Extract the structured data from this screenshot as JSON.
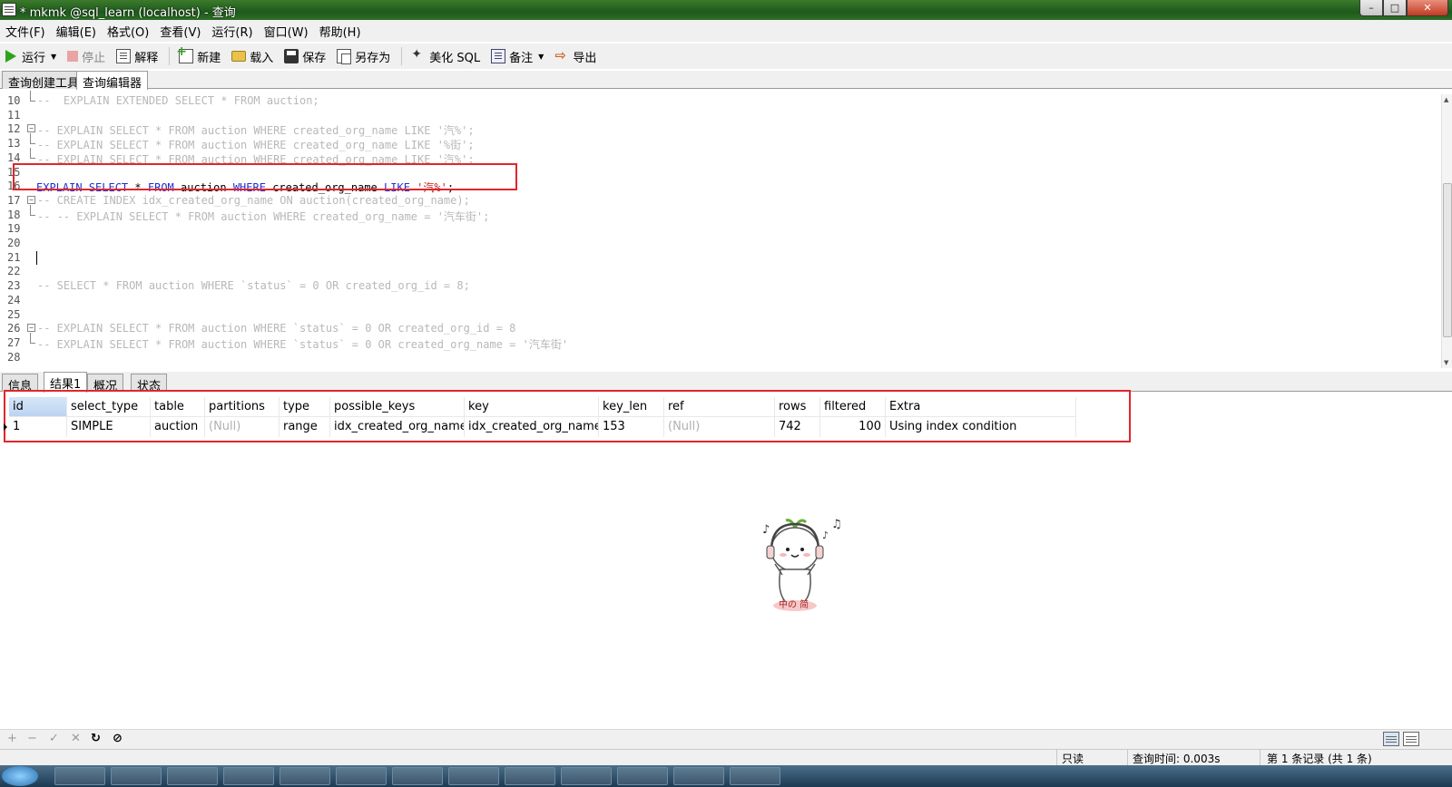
{
  "window": {
    "title": "* mkmk @sql_learn (localhost) - 查询",
    "controls": {
      "minimize": "–",
      "maximize": "□",
      "close": "✕"
    }
  },
  "menu": [
    "文件(F)",
    "编辑(E)",
    "格式(O)",
    "查看(V)",
    "运行(R)",
    "窗口(W)",
    "帮助(H)"
  ],
  "toolbar": {
    "run": "运行",
    "stop": "停止",
    "explain": "解释",
    "new": "新建",
    "load": "载入",
    "save": "保存",
    "save_as": "另存为",
    "beautify": "美化 SQL",
    "note": "备注",
    "export": "导出"
  },
  "tabs": {
    "builder": "查询创建工具",
    "editor": "查询编辑器"
  },
  "editor": {
    "lines": [
      {
        "n": "10",
        "text": "--  EXPLAIN EXTENDED SELECT * FROM auction;",
        "fold": "end"
      },
      {
        "n": "11",
        "text": "",
        "fold": ""
      },
      {
        "n": "12",
        "text": "-- EXPLAIN SELECT * FROM auction WHERE created_org_name LIKE '汽%';",
        "fold": "start"
      },
      {
        "n": "13",
        "text": "-- EXPLAIN SELECT * FROM auction WHERE created_org_name LIKE '%街';",
        "fold": "mid"
      },
      {
        "n": "14",
        "text": "-- EXPLAIN SELECT * FROM auction WHERE created_org_name LIKE '汽%';",
        "fold": "end"
      },
      {
        "n": "15",
        "text": "",
        "fold": ""
      },
      {
        "n": "16",
        "text": "",
        "fold": ""
      },
      {
        "n": "17",
        "text": "-- CREATE INDEX idx_created_org_name ON auction(created_org_name);",
        "fold": "start"
      },
      {
        "n": "18",
        "text": "-- -- EXPLAIN SELECT * FROM auction WHERE created_org_name = '汽车街';",
        "fold": "end"
      },
      {
        "n": "19",
        "text": "",
        "fold": ""
      },
      {
        "n": "20",
        "text": "",
        "fold": ""
      },
      {
        "n": "21",
        "text": "",
        "fold": ""
      },
      {
        "n": "22",
        "text": "",
        "fold": ""
      },
      {
        "n": "23",
        "text": "-- SELECT * FROM auction WHERE `status` = 0 OR created_org_id = 8;",
        "fold": ""
      },
      {
        "n": "24",
        "text": "",
        "fold": ""
      },
      {
        "n": "25",
        "text": "",
        "fold": ""
      },
      {
        "n": "26",
        "text": "-- EXPLAIN SELECT * FROM auction WHERE `status` = 0 OR created_org_id = 8",
        "fold": "start"
      },
      {
        "n": "27",
        "text": "-- EXPLAIN SELECT * FROM auction WHERE `status` = 0 OR created_org_name = '汽车街'",
        "fold": "end"
      },
      {
        "n": "28",
        "text": "",
        "fold": ""
      }
    ],
    "active_statement": {
      "kw1": "EXPLAIN",
      "kw2": "SELECT",
      "star": "*",
      "kw3": "FROM",
      "table": "auction",
      "kw4": "WHERE",
      "column": "created_org_name",
      "kw5": "LIKE",
      "literal": "'汽%'",
      "end": ";"
    }
  },
  "result_tabs": [
    "信息",
    "结果1",
    "概况",
    "状态"
  ],
  "result": {
    "columns": [
      "id",
      "select_type",
      "table",
      "partitions",
      "type",
      "possible_keys",
      "key",
      "key_len",
      "ref",
      "rows",
      "filtered",
      "Extra"
    ],
    "rows": [
      [
        "1",
        "SIMPLE",
        "auction",
        "(Null)",
        "range",
        "idx_created_org_name",
        "idx_created_org_name",
        "153",
        "(Null)",
        "742",
        "100",
        "Using index condition"
      ]
    ]
  },
  "bottom_toolbar": {
    "add": "+",
    "remove": "−",
    "apply": "✓",
    "discard": "✕",
    "refresh": "↻",
    "stop": "⊘"
  },
  "status": {
    "readonly": "只读",
    "query_time": "查询时间: 0.003s",
    "records": "第 1 条记录 (共 1 条)"
  },
  "colors": {
    "highlight_border": "#e0262b",
    "keyword": "#1f2fd0",
    "string": "#c02020",
    "comment": "#b8b8b8"
  }
}
